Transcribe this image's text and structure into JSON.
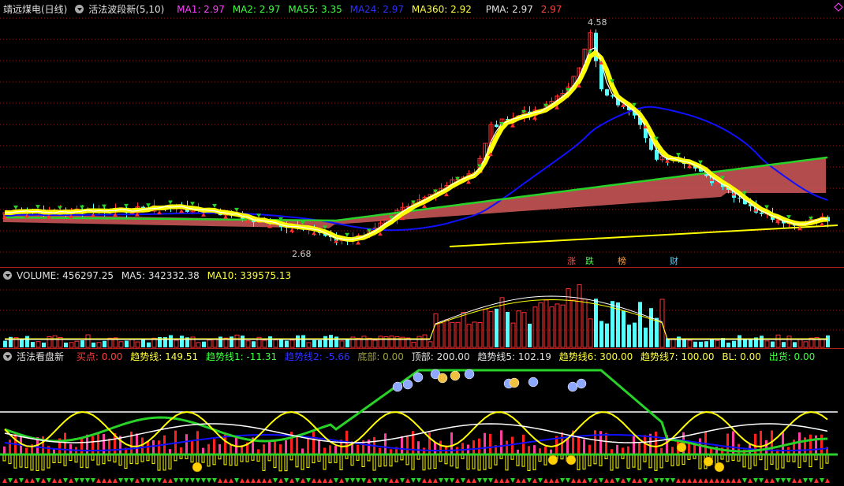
{
  "header": {
    "stock_name": "靖远煤电(日线)",
    "indicator": "活法波段新(5,10)",
    "ma1_label": "MA1: 2.97",
    "ma2_label": "MA2: 2.97",
    "ma55_label": "MA55: 3.35",
    "ma24_label": "MA24: 2.97",
    "ma360_label": "MA360: 2.92",
    "pma_label": "PMA: 2.97",
    "pma_value": "2.97"
  },
  "price_panel": {
    "high_label": "4.58",
    "low_label": "2.68",
    "markers": [
      "涨",
      "跌",
      "榜",
      "财"
    ]
  },
  "volume_panel": {
    "volume_label": "VOLUME: 456297.25",
    "ma5_label": "MA5: 342332.38",
    "ma10_label": "MA10: 339575.13"
  },
  "indicator_panel": {
    "name": "活法看盘新",
    "buy_label": "买点: 0.00",
    "trend_label": "趋势线: 149.51",
    "trend1_label": "趋势线1: -11.31",
    "trend2_label": "趋势线2: -5.66",
    "bottom_label": "底部: 0.00",
    "top_label": "顶部: 200.00",
    "trend5_label": "趋势线5: 102.19",
    "trend6_label": "趋势线6: 300.00",
    "trend7_label": "趋势线7: 100.00",
    "bl_label": "BL: 0.00",
    "sell_label": "出货: 0.00"
  },
  "colors": {
    "background": "#000000",
    "up": "#ff3232",
    "down": "#54ffff",
    "ma_white": "#ffffff",
    "ma_yellow": "#ffff00",
    "ma_blue": "#1010ff",
    "ma_green": "#28d228",
    "band_fill": "#d25a5a",
    "grid": "#8b1a1a"
  },
  "icons": [
    "dropdown-icon",
    "smiley-icon",
    "sad-face-icon",
    "money-bag-icon",
    "up-arrow-icon",
    "down-arrow-icon"
  ]
}
